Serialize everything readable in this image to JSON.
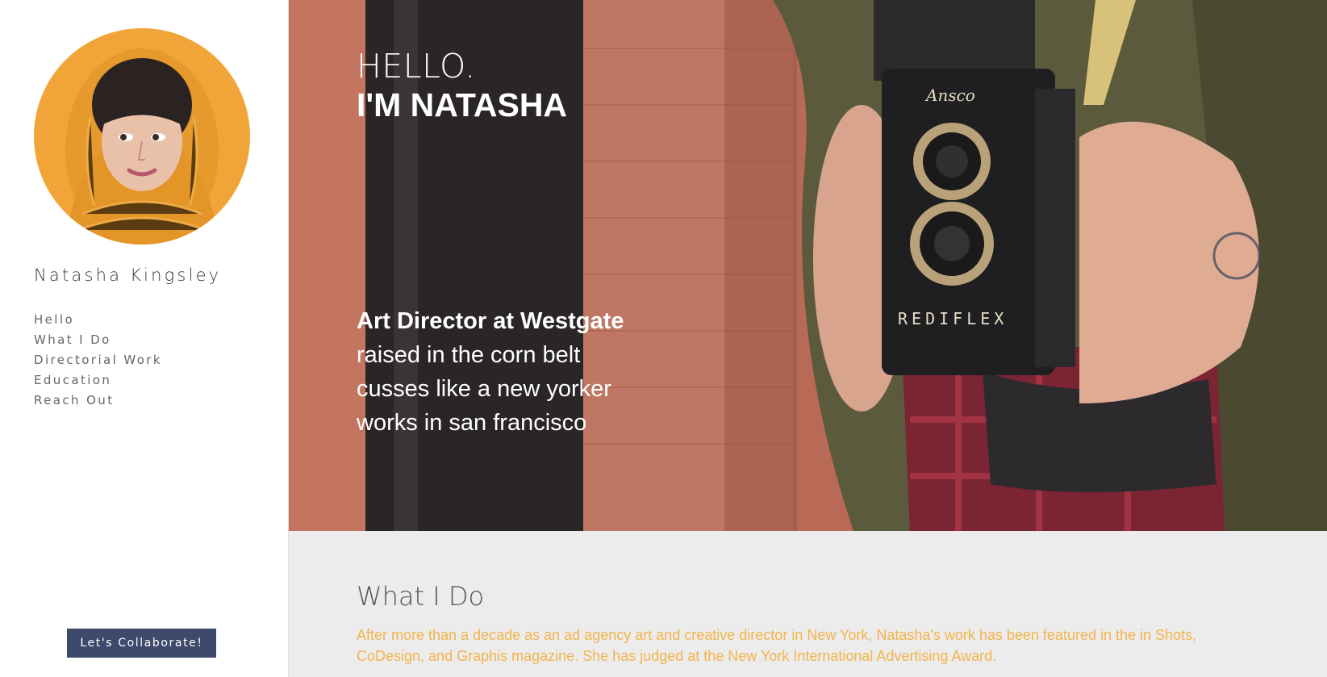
{
  "sidebar": {
    "name": "Natasha Kingsley",
    "nav": [
      "Hello",
      "What I Do",
      "Directorial Work",
      "Education",
      "Reach Out"
    ],
    "cta_label": "Let's Collaborate!"
  },
  "hero": {
    "greeting": "HELLO.",
    "intro": "I'M NATASHA",
    "role": "Art Director at Westgate",
    "bio_lines": [
      "raised in the corn belt",
      "cusses like a new yorker",
      "works in san francisco"
    ],
    "camera_brand": "Ansco",
    "camera_model": "REDIFLEX"
  },
  "what_i_do": {
    "title": "What I Do",
    "body": "After more than a decade as an ad agency art and creative director in New York, Natasha's work has been featured in the in Shots, CoDesign, and Graphis magazine. She has judged at the New York International Advertising Award."
  },
  "colors": {
    "accent": "#f3b44b",
    "button": "#3e4a6b",
    "section_bg": "#ececec"
  }
}
